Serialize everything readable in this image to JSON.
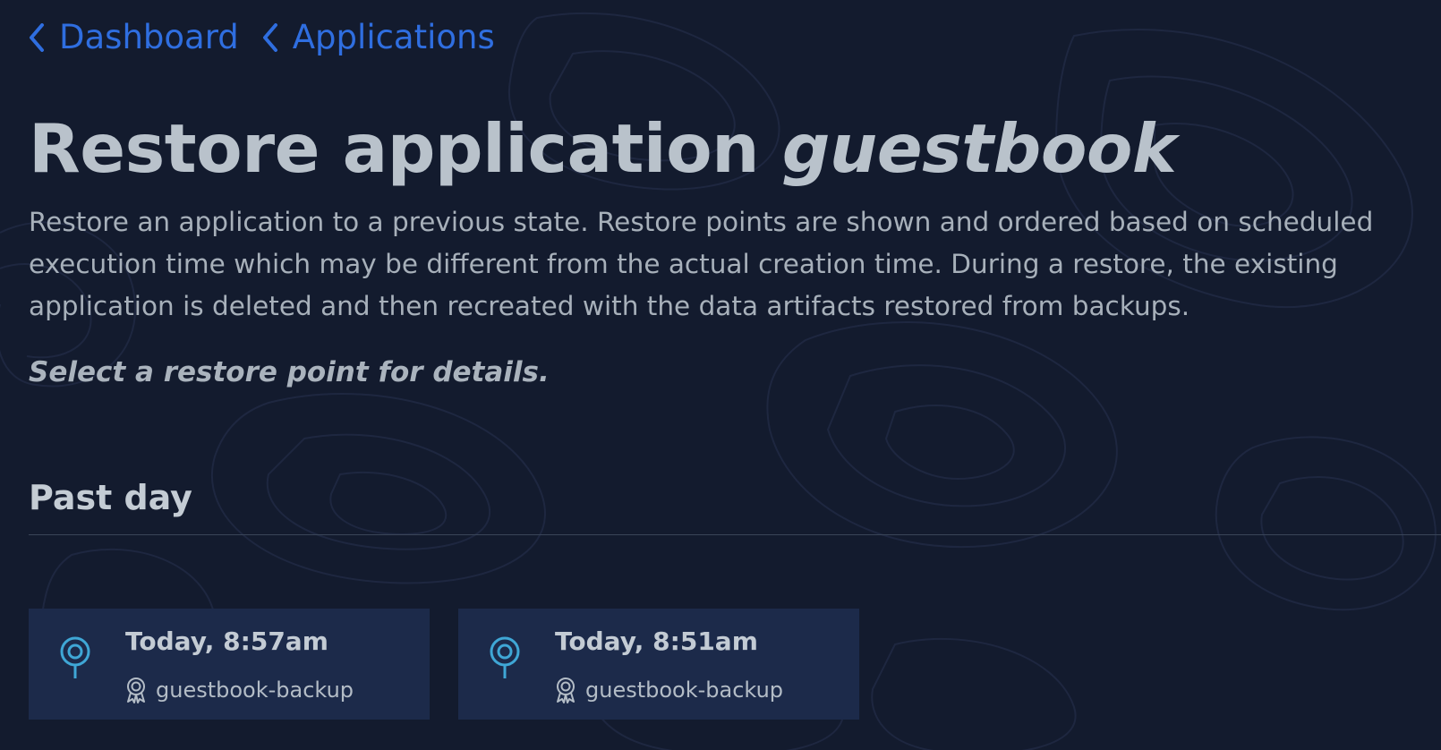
{
  "breadcrumb": {
    "items": [
      {
        "label": "Dashboard"
      },
      {
        "label": "Applications"
      }
    ]
  },
  "header": {
    "title_prefix": "Restore application",
    "app_name": "guestbook"
  },
  "description": "Restore an application to a previous state. Restore points are shown and ordered based on scheduled execution time which may be different from the actual creation time. During a restore, the existing application is deleted and then recreated with the data artifacts restored from backups.",
  "hint": "Select a restore point for details.",
  "section": {
    "title": "Past day",
    "restore_points": [
      {
        "time": "Today, 8:57am",
        "policy": "guestbook-backup",
        "icon": "location-pin-icon",
        "policy_icon": "award-ribbon-icon"
      },
      {
        "time": "Today, 8:51am",
        "policy": "guestbook-backup",
        "icon": "location-pin-icon",
        "policy_icon": "award-ribbon-icon"
      }
    ]
  },
  "colors": {
    "background": "#131b2e",
    "link": "#2f6ee0",
    "card": "#1c2a4a",
    "pin": "#3fa7d6"
  }
}
